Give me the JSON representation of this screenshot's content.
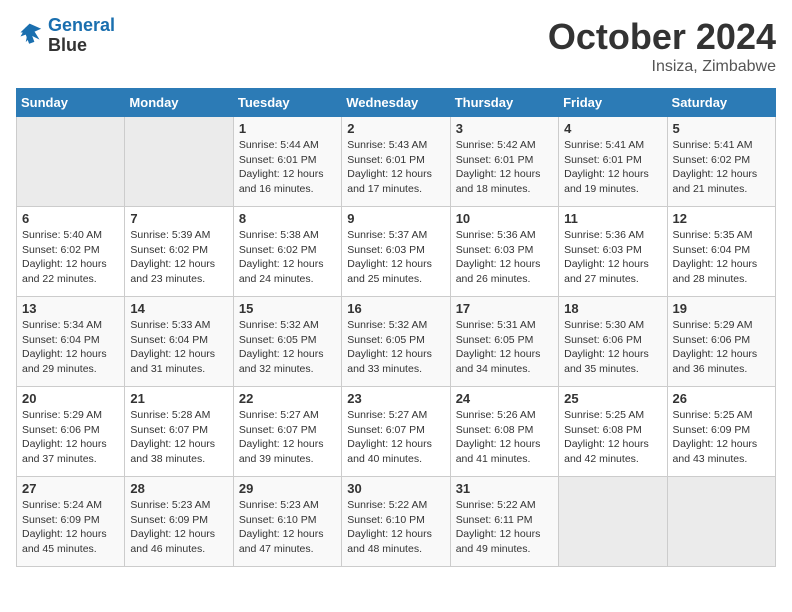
{
  "logo": {
    "line1": "General",
    "line2": "Blue"
  },
  "title": "October 2024",
  "subtitle": "Insiza, Zimbabwe",
  "days_header": [
    "Sunday",
    "Monday",
    "Tuesday",
    "Wednesday",
    "Thursday",
    "Friday",
    "Saturday"
  ],
  "weeks": [
    [
      {
        "day": "",
        "sunrise": "",
        "sunset": "",
        "daylight": ""
      },
      {
        "day": "",
        "sunrise": "",
        "sunset": "",
        "daylight": ""
      },
      {
        "day": "1",
        "sunrise": "Sunrise: 5:44 AM",
        "sunset": "Sunset: 6:01 PM",
        "daylight": "Daylight: 12 hours and 16 minutes."
      },
      {
        "day": "2",
        "sunrise": "Sunrise: 5:43 AM",
        "sunset": "Sunset: 6:01 PM",
        "daylight": "Daylight: 12 hours and 17 minutes."
      },
      {
        "day": "3",
        "sunrise": "Sunrise: 5:42 AM",
        "sunset": "Sunset: 6:01 PM",
        "daylight": "Daylight: 12 hours and 18 minutes."
      },
      {
        "day": "4",
        "sunrise": "Sunrise: 5:41 AM",
        "sunset": "Sunset: 6:01 PM",
        "daylight": "Daylight: 12 hours and 19 minutes."
      },
      {
        "day": "5",
        "sunrise": "Sunrise: 5:41 AM",
        "sunset": "Sunset: 6:02 PM",
        "daylight": "Daylight: 12 hours and 21 minutes."
      }
    ],
    [
      {
        "day": "6",
        "sunrise": "Sunrise: 5:40 AM",
        "sunset": "Sunset: 6:02 PM",
        "daylight": "Daylight: 12 hours and 22 minutes."
      },
      {
        "day": "7",
        "sunrise": "Sunrise: 5:39 AM",
        "sunset": "Sunset: 6:02 PM",
        "daylight": "Daylight: 12 hours and 23 minutes."
      },
      {
        "day": "8",
        "sunrise": "Sunrise: 5:38 AM",
        "sunset": "Sunset: 6:02 PM",
        "daylight": "Daylight: 12 hours and 24 minutes."
      },
      {
        "day": "9",
        "sunrise": "Sunrise: 5:37 AM",
        "sunset": "Sunset: 6:03 PM",
        "daylight": "Daylight: 12 hours and 25 minutes."
      },
      {
        "day": "10",
        "sunrise": "Sunrise: 5:36 AM",
        "sunset": "Sunset: 6:03 PM",
        "daylight": "Daylight: 12 hours and 26 minutes."
      },
      {
        "day": "11",
        "sunrise": "Sunrise: 5:36 AM",
        "sunset": "Sunset: 6:03 PM",
        "daylight": "Daylight: 12 hours and 27 minutes."
      },
      {
        "day": "12",
        "sunrise": "Sunrise: 5:35 AM",
        "sunset": "Sunset: 6:04 PM",
        "daylight": "Daylight: 12 hours and 28 minutes."
      }
    ],
    [
      {
        "day": "13",
        "sunrise": "Sunrise: 5:34 AM",
        "sunset": "Sunset: 6:04 PM",
        "daylight": "Daylight: 12 hours and 29 minutes."
      },
      {
        "day": "14",
        "sunrise": "Sunrise: 5:33 AM",
        "sunset": "Sunset: 6:04 PM",
        "daylight": "Daylight: 12 hours and 31 minutes."
      },
      {
        "day": "15",
        "sunrise": "Sunrise: 5:32 AM",
        "sunset": "Sunset: 6:05 PM",
        "daylight": "Daylight: 12 hours and 32 minutes."
      },
      {
        "day": "16",
        "sunrise": "Sunrise: 5:32 AM",
        "sunset": "Sunset: 6:05 PM",
        "daylight": "Daylight: 12 hours and 33 minutes."
      },
      {
        "day": "17",
        "sunrise": "Sunrise: 5:31 AM",
        "sunset": "Sunset: 6:05 PM",
        "daylight": "Daylight: 12 hours and 34 minutes."
      },
      {
        "day": "18",
        "sunrise": "Sunrise: 5:30 AM",
        "sunset": "Sunset: 6:06 PM",
        "daylight": "Daylight: 12 hours and 35 minutes."
      },
      {
        "day": "19",
        "sunrise": "Sunrise: 5:29 AM",
        "sunset": "Sunset: 6:06 PM",
        "daylight": "Daylight: 12 hours and 36 minutes."
      }
    ],
    [
      {
        "day": "20",
        "sunrise": "Sunrise: 5:29 AM",
        "sunset": "Sunset: 6:06 PM",
        "daylight": "Daylight: 12 hours and 37 minutes."
      },
      {
        "day": "21",
        "sunrise": "Sunrise: 5:28 AM",
        "sunset": "Sunset: 6:07 PM",
        "daylight": "Daylight: 12 hours and 38 minutes."
      },
      {
        "day": "22",
        "sunrise": "Sunrise: 5:27 AM",
        "sunset": "Sunset: 6:07 PM",
        "daylight": "Daylight: 12 hours and 39 minutes."
      },
      {
        "day": "23",
        "sunrise": "Sunrise: 5:27 AM",
        "sunset": "Sunset: 6:07 PM",
        "daylight": "Daylight: 12 hours and 40 minutes."
      },
      {
        "day": "24",
        "sunrise": "Sunrise: 5:26 AM",
        "sunset": "Sunset: 6:08 PM",
        "daylight": "Daylight: 12 hours and 41 minutes."
      },
      {
        "day": "25",
        "sunrise": "Sunrise: 5:25 AM",
        "sunset": "Sunset: 6:08 PM",
        "daylight": "Daylight: 12 hours and 42 minutes."
      },
      {
        "day": "26",
        "sunrise": "Sunrise: 5:25 AM",
        "sunset": "Sunset: 6:09 PM",
        "daylight": "Daylight: 12 hours and 43 minutes."
      }
    ],
    [
      {
        "day": "27",
        "sunrise": "Sunrise: 5:24 AM",
        "sunset": "Sunset: 6:09 PM",
        "daylight": "Daylight: 12 hours and 45 minutes."
      },
      {
        "day": "28",
        "sunrise": "Sunrise: 5:23 AM",
        "sunset": "Sunset: 6:09 PM",
        "daylight": "Daylight: 12 hours and 46 minutes."
      },
      {
        "day": "29",
        "sunrise": "Sunrise: 5:23 AM",
        "sunset": "Sunset: 6:10 PM",
        "daylight": "Daylight: 12 hours and 47 minutes."
      },
      {
        "day": "30",
        "sunrise": "Sunrise: 5:22 AM",
        "sunset": "Sunset: 6:10 PM",
        "daylight": "Daylight: 12 hours and 48 minutes."
      },
      {
        "day": "31",
        "sunrise": "Sunrise: 5:22 AM",
        "sunset": "Sunset: 6:11 PM",
        "daylight": "Daylight: 12 hours and 49 minutes."
      },
      {
        "day": "",
        "sunrise": "",
        "sunset": "",
        "daylight": ""
      },
      {
        "day": "",
        "sunrise": "",
        "sunset": "",
        "daylight": ""
      }
    ]
  ]
}
